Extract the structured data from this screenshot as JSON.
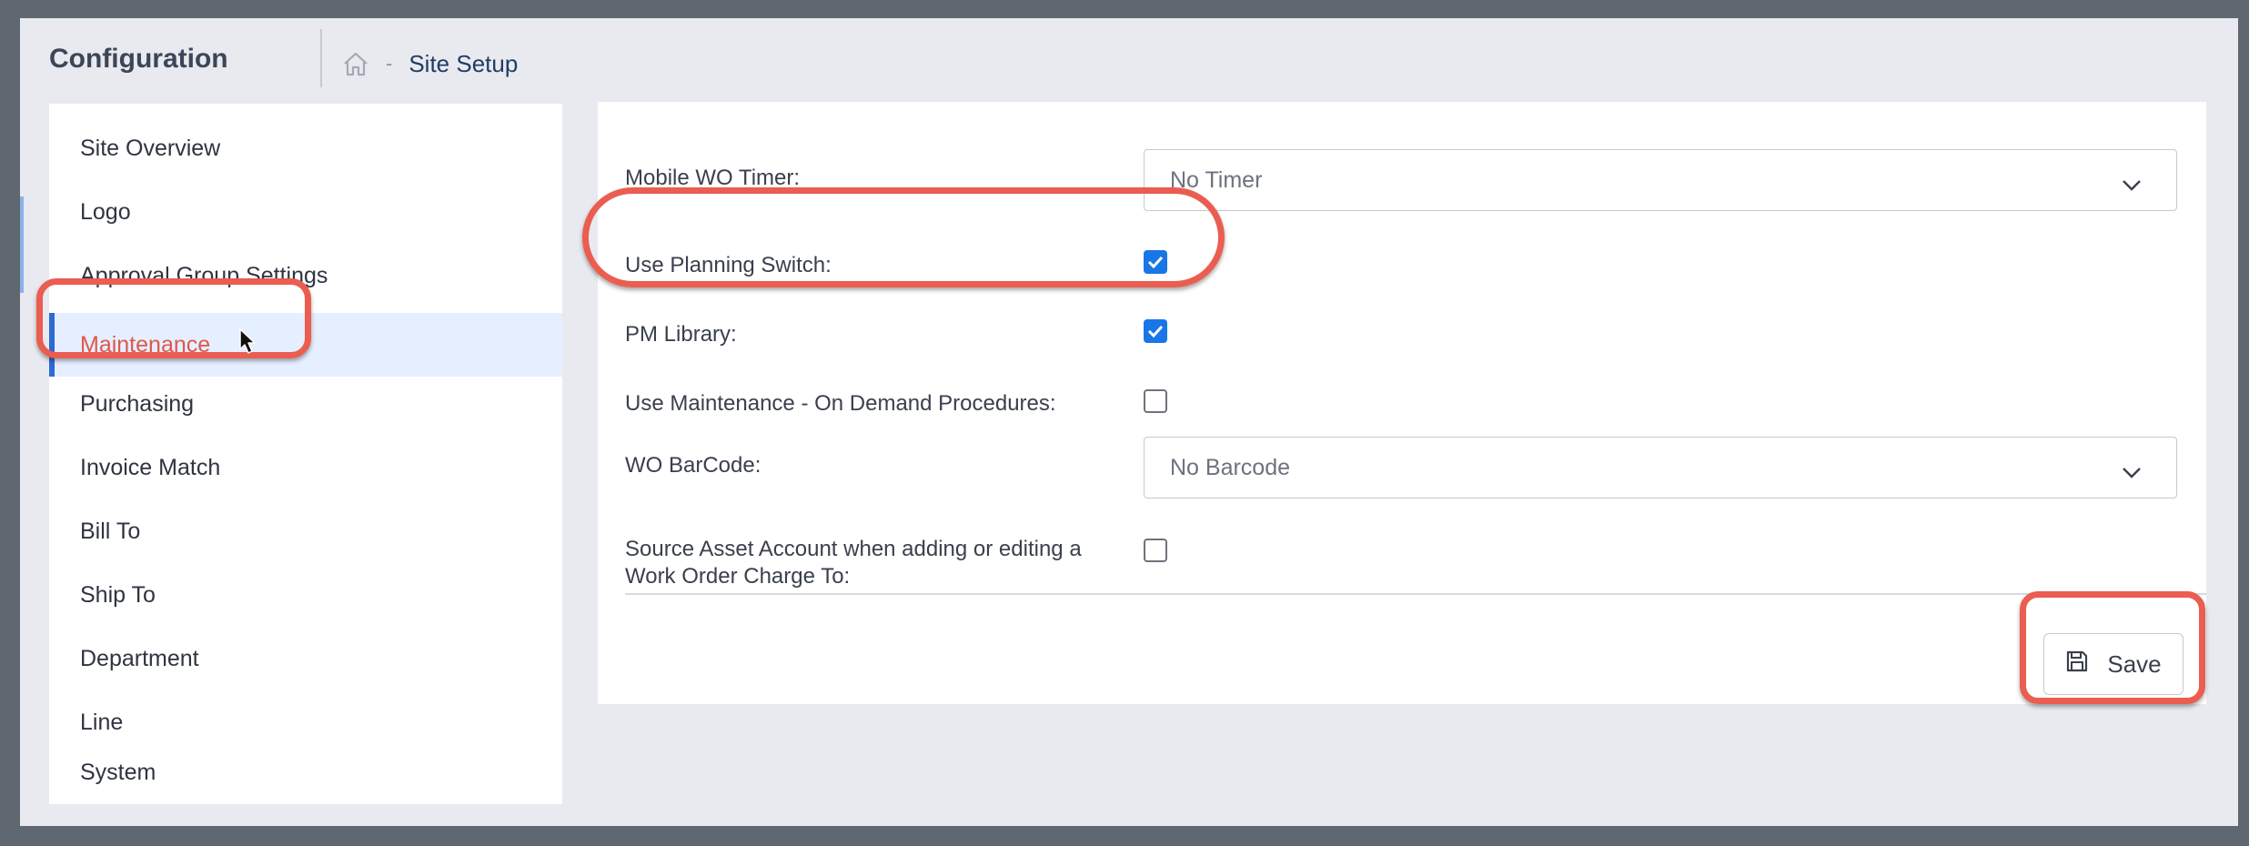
{
  "app": {
    "title": "Configuration"
  },
  "breadcrumb": {
    "home_icon": "home-icon",
    "separator": "-",
    "current": "Site Setup"
  },
  "sidebar": {
    "items": [
      {
        "label": "Site Overview"
      },
      {
        "label": "Logo"
      },
      {
        "label": "Approval Group Settings"
      },
      {
        "label": "Maintenance",
        "active": true
      },
      {
        "label": "Purchasing"
      },
      {
        "label": "Invoice Match"
      },
      {
        "label": "Bill To"
      },
      {
        "label": "Ship To"
      },
      {
        "label": "Department"
      },
      {
        "label": "Line"
      },
      {
        "label": "System"
      }
    ]
  },
  "form": {
    "mobile_wo_timer": {
      "label": "Mobile WO Timer:",
      "value": "No Timer"
    },
    "use_planning_switch": {
      "label": "Use Planning Switch:",
      "checked": true
    },
    "pm_library": {
      "label": "PM Library:",
      "checked": true
    },
    "on_demand_procedures": {
      "label": "Use Maintenance - On Demand Procedures:",
      "checked": false
    },
    "wo_barcode": {
      "label": "WO BarCode:",
      "value": "No Barcode"
    },
    "source_asset_account": {
      "label_line1": "Source Asset Account when adding or editing a",
      "label_line2": "Work Order Charge To:",
      "checked": false
    },
    "save_label": "Save"
  },
  "colors": {
    "accent": "#1976e6",
    "active_text": "#e0574a",
    "highlight": "#ea5d50",
    "active_bg": "#e5efff"
  }
}
